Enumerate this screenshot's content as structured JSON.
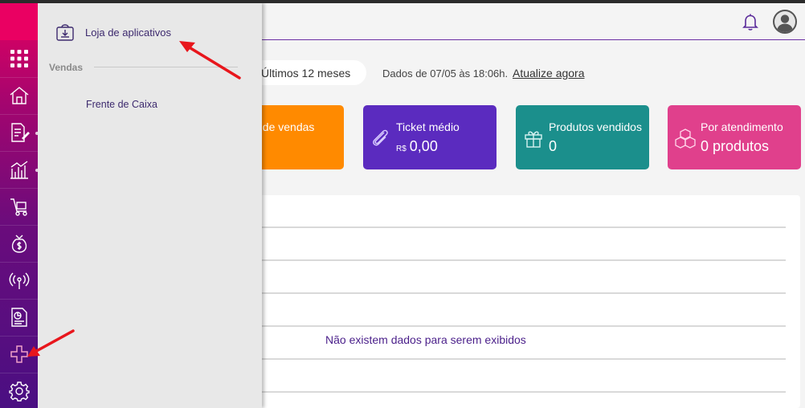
{
  "flyout": {
    "store_label": "Loja de aplicativos",
    "section_title": "Vendas",
    "items": [
      {
        "label": "Frente de Caixa"
      }
    ]
  },
  "rail": {
    "icons": [
      "grid-icon",
      "home-icon",
      "document-edit-icon",
      "chart-icon",
      "cart-icon",
      "money-bag-icon",
      "broadcast-icon",
      "report-icon",
      "plugin-icon",
      "gear-icon"
    ]
  },
  "header": {
    "period_label": "Últimos 12 meses",
    "updated_text": "Dados de 07/05 às 18:06h.",
    "refresh_label": "Atualize agora"
  },
  "cards": [
    {
      "title": "al de vendas",
      "currency": "",
      "value": "",
      "color": "#ff8a00"
    },
    {
      "title": "Ticket médio",
      "currency": "R$",
      "value": "0,00",
      "color": "#5b2bbf"
    },
    {
      "title": "Produtos vendidos",
      "currency": "",
      "value": "0",
      "color": "#1b8f8c"
    },
    {
      "title": "Por atendimento",
      "currency": "",
      "value": "0 produtos",
      "color": "#e0408c"
    }
  ],
  "table": {
    "empty_message": "Não existem dados para serem exibidos"
  },
  "colors": {
    "accent_purple": "#6a2fa3",
    "annotation_red": "#e8161c"
  }
}
